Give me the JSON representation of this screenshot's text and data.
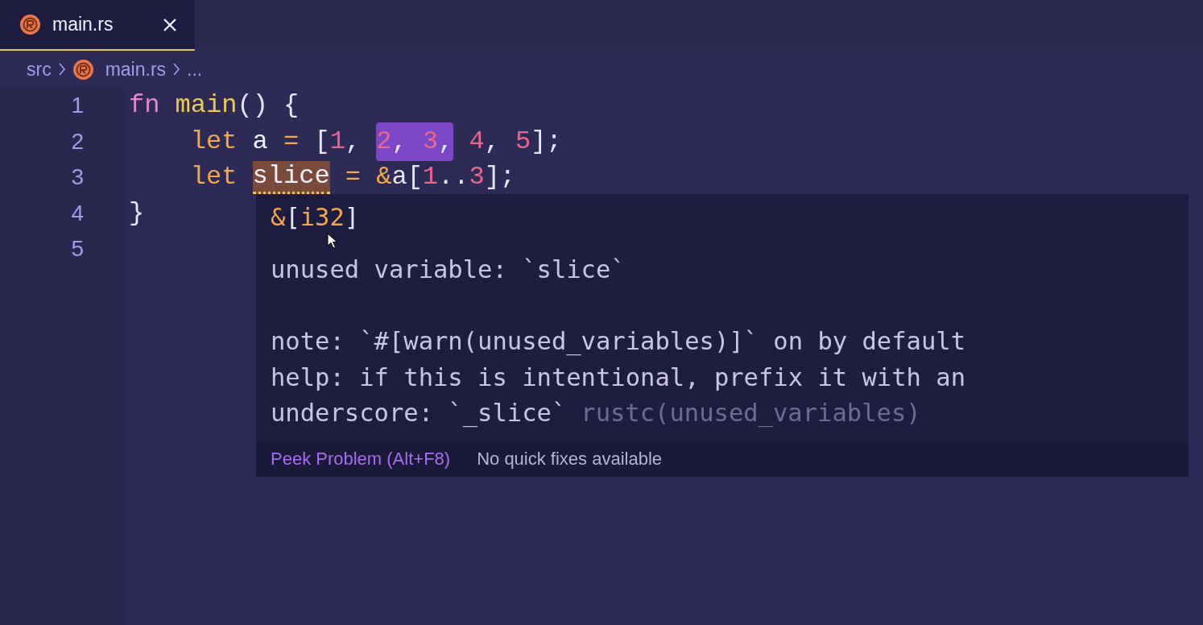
{
  "tabs": [
    {
      "label": "main.rs",
      "selected": true
    }
  ],
  "breadcrumb": [
    {
      "label": "src",
      "kind": "folder"
    },
    {
      "label": "main.rs",
      "kind": "file"
    },
    {
      "label": "...",
      "kind": "more"
    }
  ],
  "lines": [
    {
      "number": "1",
      "tokens": [
        {
          "text": "fn",
          "kind": "fnkw"
        },
        {
          "text": " main",
          "kind": "func"
        },
        {
          "text": "() {",
          "kind": "punct"
        }
      ],
      "children": [
        {
          "number": "2",
          "tokens": [
            {
              "text": "let",
              "kind": "keyword"
            },
            {
              "text": " a",
              "kind": "plain"
            },
            {
              "text": " =",
              "kind": "op"
            },
            {
              "text": " [",
              "kind": "punct"
            },
            {
              "text": "1",
              "kind": "num"
            },
            {
              "text": ", ",
              "kind": "punct"
            },
            {
              "kind": "selection",
              "tokens": [
                {
                  "text": "2",
                  "kind": "num"
                },
                {
                  "text": ", ",
                  "kind": "punct"
                },
                {
                  "text": "3",
                  "kind": "num"
                },
                {
                  "text": ",",
                  "kind": "punct"
                }
              ]
            },
            {
              "text": " 4",
              "kind": "num"
            },
            {
              "text": ", ",
              "kind": "punct"
            },
            {
              "text": "5",
              "kind": "num"
            },
            {
              "text": "];",
              "kind": "punct"
            }
          ]
        },
        {
          "number": "3",
          "tokens": [
            {
              "text": "let ",
              "kind": "keyword"
            },
            {
              "kind": "warning",
              "tokens": [
                {
                  "text": "slice",
                  "kind": "plain"
                }
              ]
            },
            {
              "text": " =",
              "kind": "op"
            },
            {
              "text": " &",
              "kind": "op"
            },
            {
              "text": "a[",
              "kind": "punct"
            },
            {
              "text": "1",
              "kind": "num"
            },
            {
              "text": "..",
              "kind": "punct"
            },
            {
              "text": "3",
              "kind": "num"
            },
            {
              "text": "];",
              "kind": "punct"
            }
          ]
        }
      ]
    },
    {
      "number": "4",
      "tokens": [
        {
          "text": "}",
          "kind": "punct"
        }
      ]
    },
    {
      "number": "5"
    }
  ],
  "hover": {
    "type_tokens": [
      {
        "text": "&",
        "kind": "op"
      },
      {
        "text": "[",
        "kind": "punct"
      },
      {
        "text": "i32",
        "kind": "keyword"
      },
      {
        "text": "]",
        "kind": "punct"
      }
    ],
    "message": "unused variable: `slice`",
    "details": [
      "note: `#[warn(unused_variables)]` on by default",
      "help: if this is intentional, prefix it with an",
      "underscore: `_slice`"
    ],
    "source": "rustc(unused_variables)",
    "actions": [
      {
        "label": "Peek Problem (Alt+F8)",
        "kind": "link"
      },
      {
        "label": "No quick fixes available",
        "kind": "text"
      }
    ]
  }
}
